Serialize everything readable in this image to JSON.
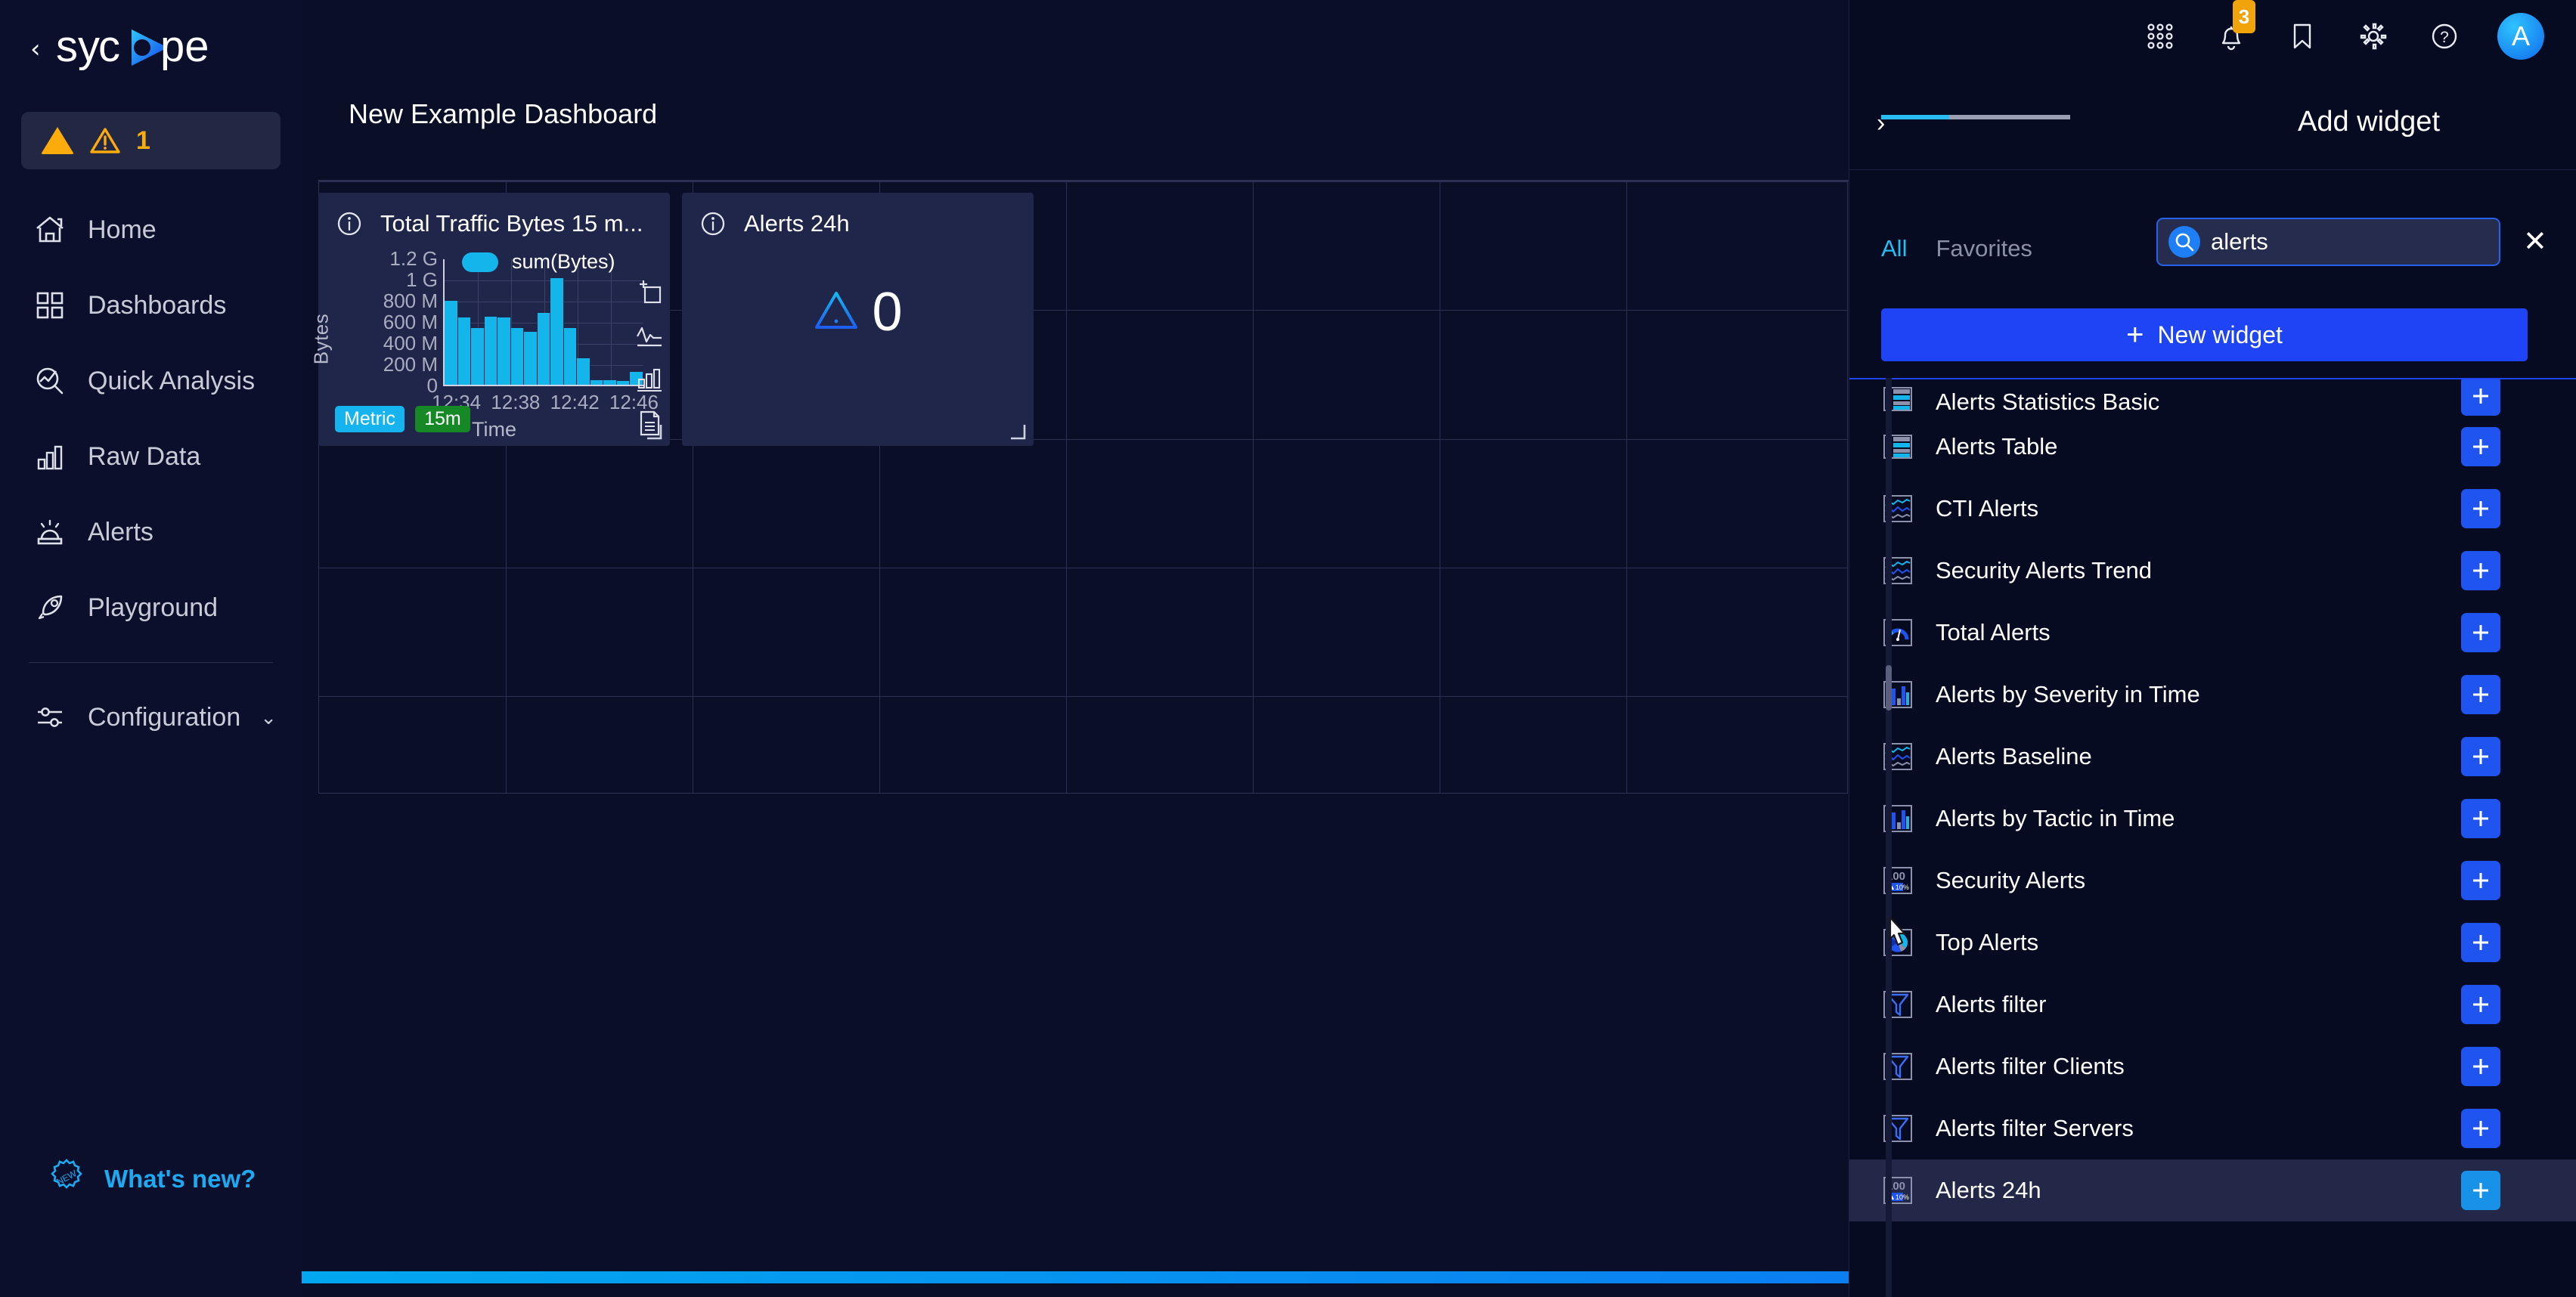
{
  "brand": {
    "name": "sycope",
    "back_icon": "chevron-left-icon",
    "accent": "#13b5ea"
  },
  "sidebar": {
    "alert_badge": {
      "count": "1",
      "color": "#fbab0b",
      "triangle_icon": "triangle-solid-icon",
      "warning_icon": "warning-triangle-icon"
    },
    "items": [
      {
        "label": "Home",
        "icon": "home-icon"
      },
      {
        "label": "Dashboards",
        "icon": "grid-squares-icon"
      },
      {
        "label": "Quick Analysis",
        "icon": "analysis-magnifier-icon"
      },
      {
        "label": "Raw Data",
        "icon": "bar-chart-icon"
      },
      {
        "label": "Alerts",
        "icon": "siren-icon"
      },
      {
        "label": "Playground",
        "icon": "rocket-icon"
      }
    ],
    "config": {
      "label": "Configuration",
      "icon": "sliders-icon",
      "chevron": "chevron-down-icon"
    },
    "whats_new": {
      "label": "What's new?",
      "icon": "new-badge-icon",
      "color": "#1fa9f0"
    }
  },
  "topbar": {
    "icons": [
      {
        "name": "apps-grid-icon"
      },
      {
        "name": "bell-icon",
        "badge": "3",
        "badge_color": "#f0a30a"
      },
      {
        "name": "bookmark-icon"
      },
      {
        "name": "gear-icon"
      },
      {
        "name": "help-circle-icon"
      }
    ],
    "avatar": {
      "initial": "A"
    }
  },
  "main": {
    "dashboard_title": "New Example Dashboard",
    "widgets": [
      {
        "title": "Total Traffic Bytes 15 m...",
        "info_icon": "info-circle-icon",
        "tags": [
          {
            "label": "Metric",
            "color": "#15b4ee"
          },
          {
            "label": "15m",
            "color": "#168826"
          }
        ],
        "tools": [
          {
            "name": "zoom-in-box-icon"
          },
          {
            "name": "line-chart-icon"
          },
          {
            "name": "bar-chart-icon"
          },
          {
            "name": "table-document-icon"
          }
        ],
        "resize_handle_icon": "resize-corner-icon"
      },
      {
        "title": "Alerts 24h",
        "info_icon": "info-circle-icon",
        "value": "0",
        "value_icon": "warning-triangle-icon",
        "resize_handle_icon": "resize-corner-icon"
      }
    ]
  },
  "chart_data": {
    "type": "bar",
    "title": "Total Traffic Bytes 15 m...",
    "xlabel": "Time",
    "ylabel": "Bytes",
    "legend": [
      {
        "name": "sum(Bytes)",
        "color": "#13b5ea"
      }
    ],
    "legend_position": "top-center",
    "grid": true,
    "ylim": [
      0,
      1200000000
    ],
    "ytick_labels": [
      "1.2 G",
      "1 G",
      "800 M",
      "600 M",
      "400 M",
      "200 M",
      "0"
    ],
    "ytick_values": [
      1200000000,
      1000000000,
      800000000,
      600000000,
      400000000,
      200000000,
      0
    ],
    "xtick_labels": [
      "12:34",
      "12:38",
      "12:42",
      "12:46"
    ],
    "categories": [
      "12:33",
      "12:34",
      "12:35",
      "12:36",
      "12:37",
      "12:38",
      "12:39",
      "12:40",
      "12:41",
      "12:42",
      "12:43",
      "12:44",
      "12:45",
      "12:46",
      "12:47"
    ],
    "series": [
      {
        "name": "sum(Bytes)",
        "color": "#13b5ea",
        "values": [
          800000000,
          640000000,
          540000000,
          650000000,
          640000000,
          545000000,
          505000000,
          690000000,
          1020000000,
          540000000,
          255000000,
          40000000,
          40000000,
          35000000,
          120000000
        ]
      }
    ]
  },
  "panel": {
    "title": "Add widget",
    "collapse_icon": "chevron-right-icon",
    "tabs": [
      {
        "label": "All",
        "active": true
      },
      {
        "label": "Favorites",
        "active": false
      }
    ],
    "search": {
      "value": "alerts",
      "placeholder": "Search",
      "icon": "search-icon",
      "clear_icon": "close-x-icon"
    },
    "new_widget": {
      "label": "New widget",
      "plus_icon": "plus-icon",
      "color": "#1f44f5"
    },
    "add_icon": "plus-icon",
    "widget_list": [
      {
        "label": "Alerts Statistics Basic",
        "icon": "table-rows-icon",
        "highlighted": false,
        "clipped": true
      },
      {
        "label": "Alerts Table",
        "icon": "table-rows-icon",
        "highlighted": false
      },
      {
        "label": "CTI Alerts",
        "icon": "multi-line-chart-icon",
        "highlighted": false
      },
      {
        "label": "Security Alerts Trend",
        "icon": "multi-line-chart-icon",
        "highlighted": false
      },
      {
        "label": "Total Alerts",
        "icon": "gauge-icon",
        "highlighted": false
      },
      {
        "label": "Alerts by Severity in Time",
        "icon": "column-chart-icon",
        "highlighted": false
      },
      {
        "label": "Alerts Baseline",
        "icon": "multi-line-chart-icon",
        "highlighted": false
      },
      {
        "label": "Alerts by Tactic in Time",
        "icon": "column-chart-icon",
        "highlighted": false
      },
      {
        "label": "Security Alerts",
        "icon": "stat-number-icon",
        "highlighted": false
      },
      {
        "label": "Top Alerts",
        "icon": "pie-chart-icon",
        "highlighted": false
      },
      {
        "label": "Alerts filter",
        "icon": "funnel-icon",
        "highlighted": false
      },
      {
        "label": "Alerts filter Clients",
        "icon": "funnel-icon",
        "highlighted": false
      },
      {
        "label": "Alerts filter Servers",
        "icon": "funnel-icon",
        "highlighted": false
      },
      {
        "label": "Alerts 24h",
        "icon": "stat-number-icon",
        "highlighted": true
      }
    ]
  },
  "colors": {
    "page_bg": "#0a0e27",
    "sidebar_bg": "#0b0f2b",
    "panel_bg": "#070b22",
    "widget_bg": "#20254a",
    "accent_cyan": "#13b5ea",
    "accent_blue": "#1f44f5",
    "grid_line": "#2c3152",
    "warn": "#fbab0b"
  }
}
